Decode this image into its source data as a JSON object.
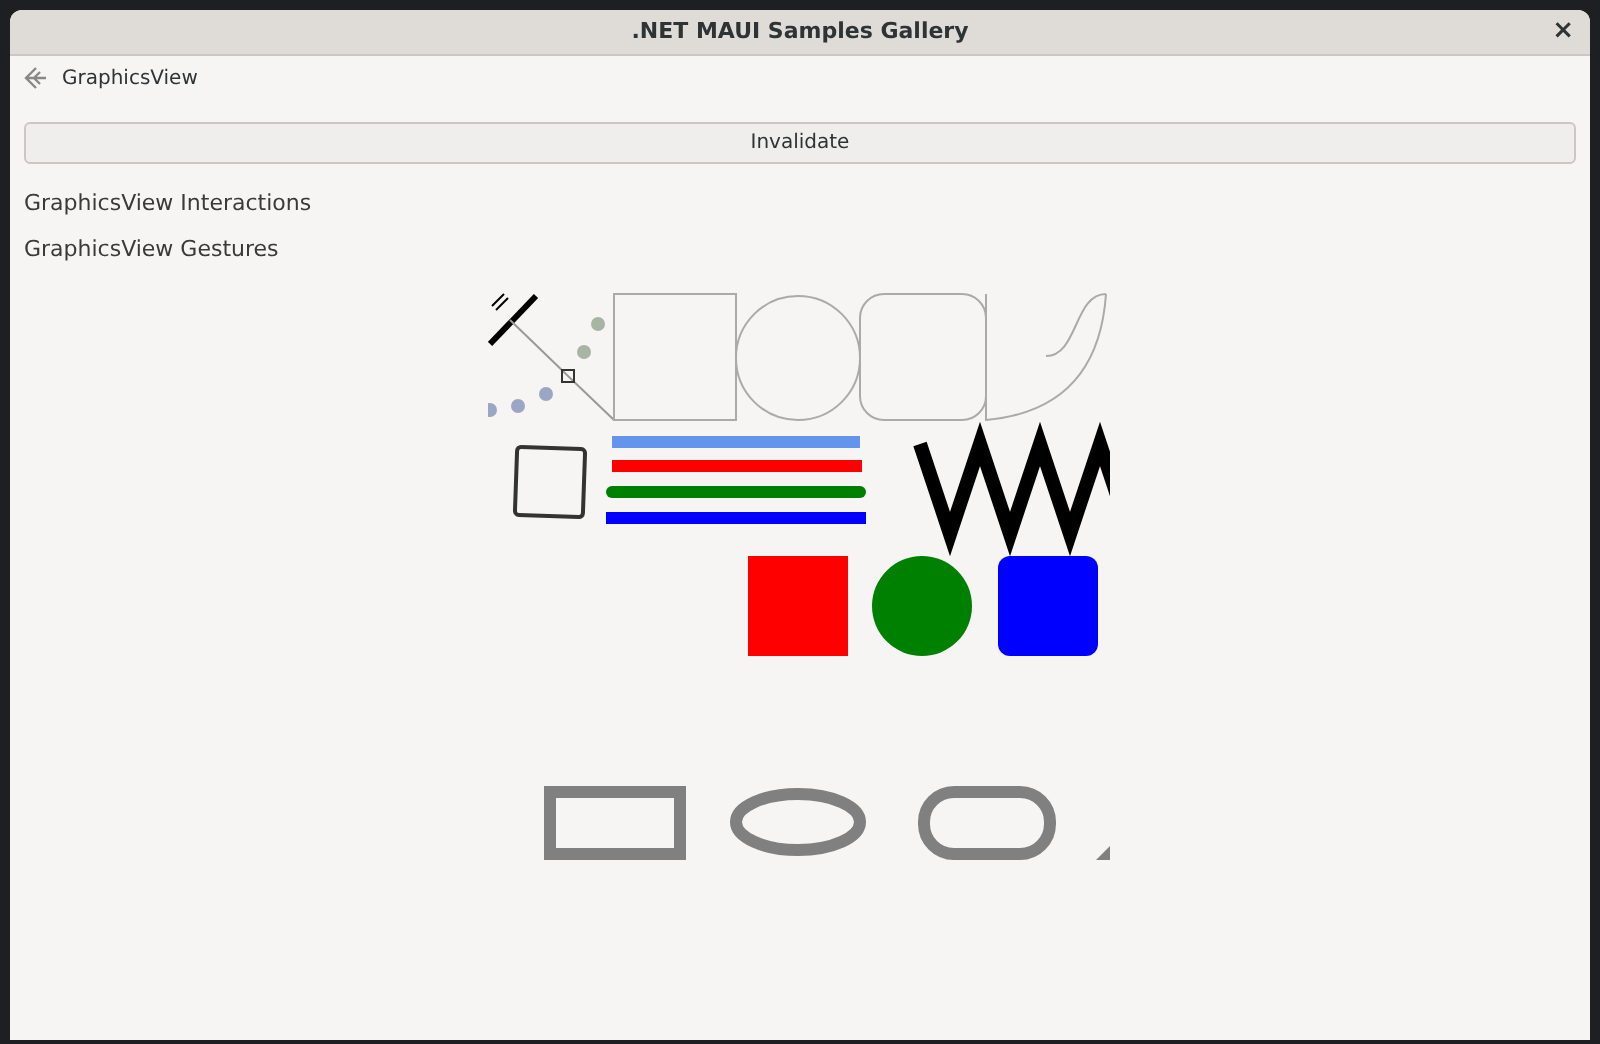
{
  "window": {
    "title": ".NET MAUI Samples Gallery",
    "close": "×"
  },
  "nav": {
    "title": "GraphicsView"
  },
  "button": {
    "label": "Invalidate"
  },
  "links": [
    {
      "label": "GraphicsView Interactions"
    },
    {
      "label": "GraphicsView Gestures"
    }
  ]
}
